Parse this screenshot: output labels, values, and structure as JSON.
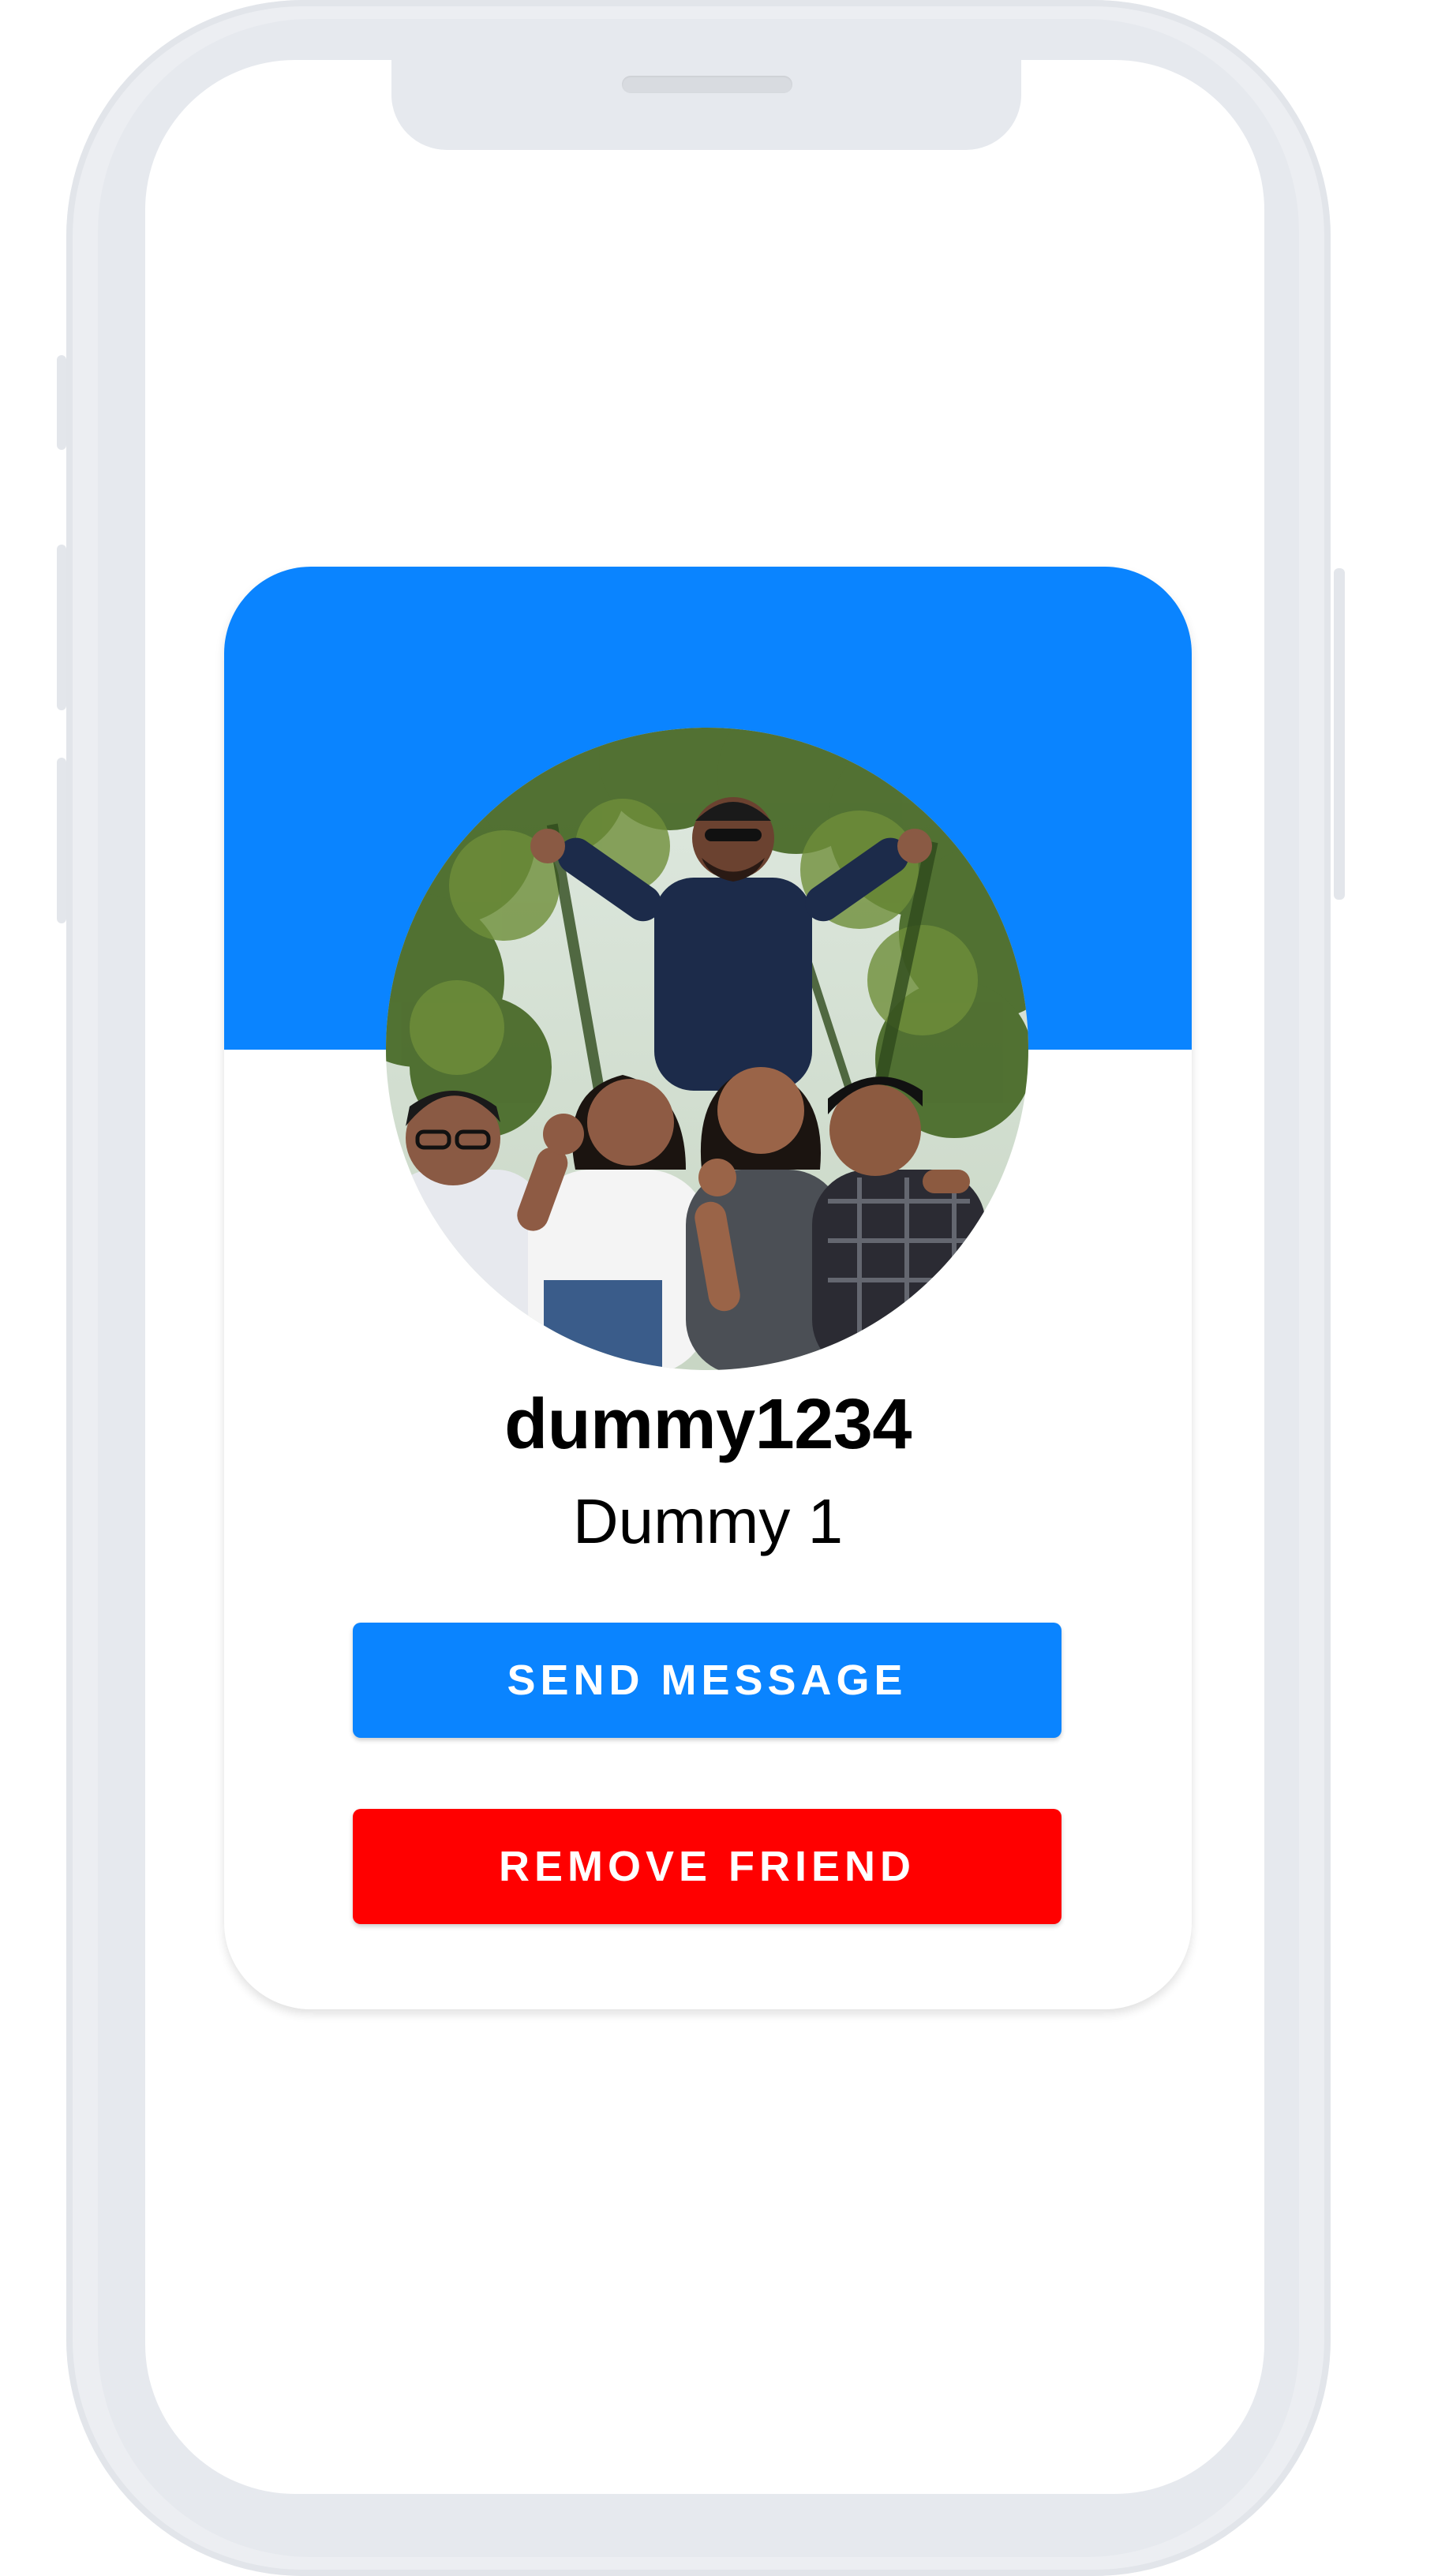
{
  "profile": {
    "username": "dummy1234",
    "display_name": "Dummy 1",
    "avatar": "group-photo-avatar"
  },
  "actions": {
    "send_message_label": "SEND MESSAGE",
    "remove_friend_label": "REMOVE FRIEND"
  },
  "colors": {
    "banner": "#0a84ff",
    "send_message": "#0a84ff",
    "remove_friend": "#ff0000",
    "card": "#ffffff"
  }
}
